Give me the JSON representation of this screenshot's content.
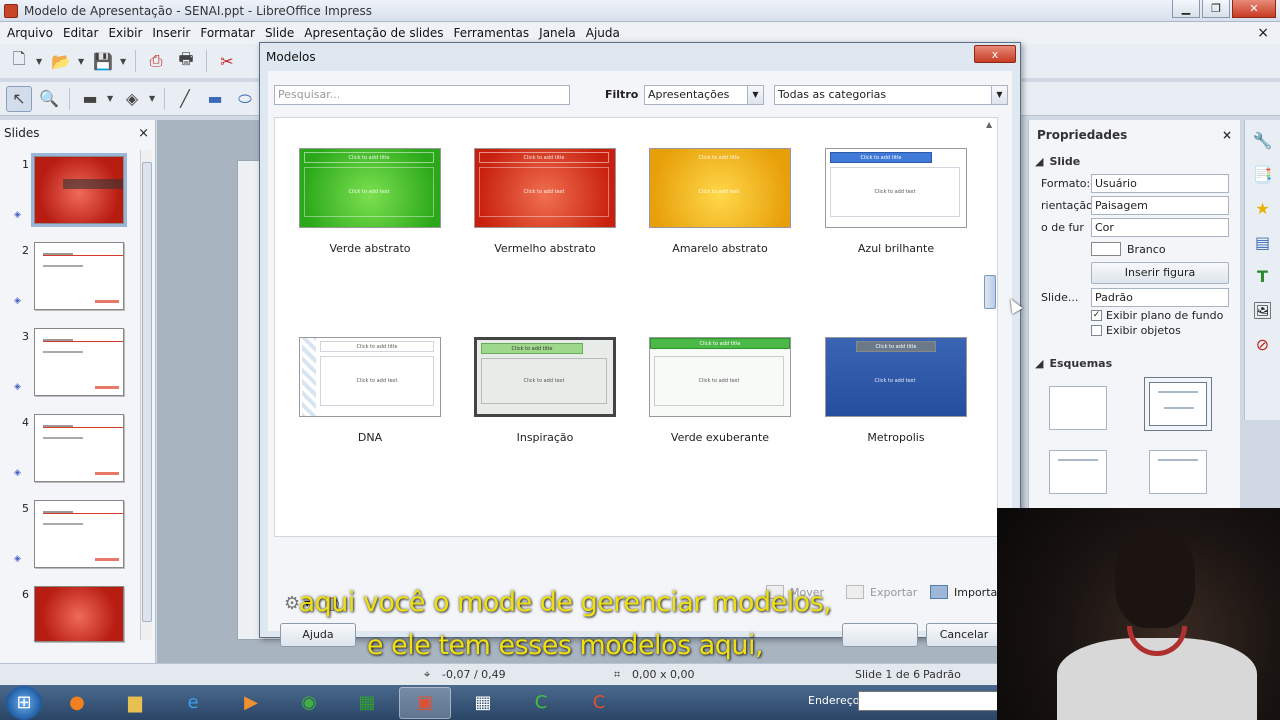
{
  "window": {
    "title": "Modelo de Apresentação - SENAI.ppt - LibreOffice Impress",
    "controls": [
      "minimize",
      "maximize",
      "close"
    ]
  },
  "menubar": {
    "items": [
      "Arquivo",
      "Editar",
      "Exibir",
      "Inserir",
      "Formatar",
      "Slide",
      "Apresentação de slides",
      "Ferramentas",
      "Janela",
      "Ajuda"
    ],
    "close": "×"
  },
  "slides_pane": {
    "title": "Slides",
    "close": "×",
    "thumbnails": [
      {
        "number": "1",
        "style": "red-title",
        "selected": true
      },
      {
        "number": "2",
        "style": "white"
      },
      {
        "number": "3",
        "style": "white"
      },
      {
        "number": "4",
        "style": "white"
      },
      {
        "number": "5",
        "style": "white"
      },
      {
        "number": "6",
        "style": "red"
      }
    ]
  },
  "properties": {
    "title": "Propriedades",
    "close": "×",
    "slide_section": "Slide",
    "rows": [
      {
        "label": "Formato:",
        "value": "Usuário"
      },
      {
        "label": "rientação:",
        "value": "Paisagem"
      },
      {
        "label": "o de fur",
        "value": "Cor"
      }
    ],
    "color_value": "Branco",
    "insert_image": "Inserir figura",
    "master_label": "Slide...",
    "master_value": "Padrão",
    "show_background": "Exibir plano de fundo",
    "show_objects": "Exibir objetos",
    "layouts_section": "Esquemas"
  },
  "dialog": {
    "title": "Modelos",
    "close": "x",
    "search_placeholder": "Pesquisar...",
    "filter_label": "Filtro",
    "filter_value": "Apresentações",
    "category_value": "Todas as categorias",
    "templates": [
      {
        "name": "Verde abstrato",
        "style": "green"
      },
      {
        "name": "Vermelho abstrato",
        "style": "red"
      },
      {
        "name": "Amarelo abstrato",
        "style": "yellow"
      },
      {
        "name": "Azul brilhante",
        "style": "blue-bright"
      },
      {
        "name": "DNA",
        "style": "dna"
      },
      {
        "name": "Inspiração",
        "style": "insp"
      },
      {
        "name": "Verde exuberante",
        "style": "verde-ex"
      },
      {
        "name": "Metropolis",
        "style": "metro"
      }
    ],
    "placeholder_title": "Click to add title",
    "placeholder_text": "Click to add text",
    "actions": {
      "move": "Mover",
      "export": "Exportar",
      "import": "Importar"
    },
    "help_button": "Ajuda",
    "cancel_button": "Cancelar"
  },
  "statusbar": {
    "position": "-0,07 / 0,49",
    "size": "0,00 x 0,00",
    "slide_info": "Slide 1 de 6",
    "master": "Padrão"
  },
  "taskbar": {
    "address_label": "Endereço"
  },
  "subtitles": [
    "aqui você o mode de gerenciar modelos,",
    "e ele tem esses modelos aqui,"
  ],
  "colors": {
    "subtitle": "#f0e010",
    "accent": "#c8452a"
  }
}
